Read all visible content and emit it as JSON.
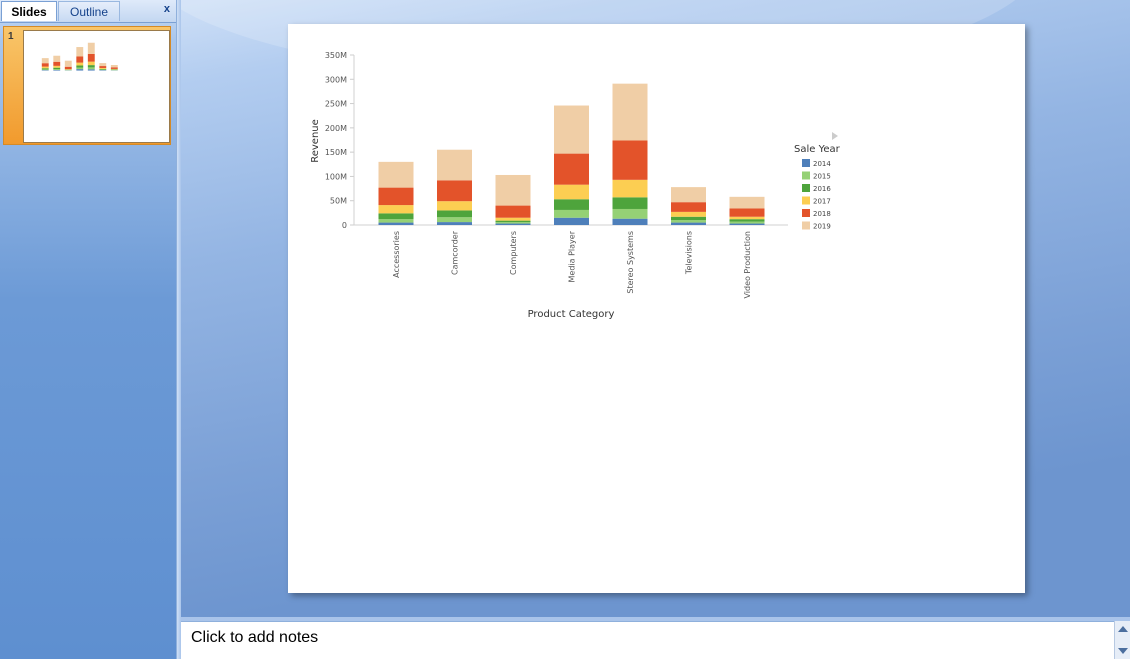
{
  "slides_pane": {
    "tabs": [
      {
        "label": "Slides"
      },
      {
        "label": "Outline"
      }
    ],
    "close_label": "x",
    "thumbnail_number": "1"
  },
  "notes": {
    "placeholder": "Click to add notes"
  },
  "colors": {
    "series": [
      "#4e7fba",
      "#95d175",
      "#4ea43c",
      "#fcce52",
      "#e3532a",
      "#f0cea6"
    ]
  },
  "chart_data": {
    "type": "bar",
    "stacked": true,
    "xlabel": "Product Category",
    "ylabel": "Revenue",
    "ylim": [
      0,
      350000000
    ],
    "yticks": [
      0,
      50000000,
      100000000,
      150000000,
      200000000,
      250000000,
      300000000,
      350000000
    ],
    "ytick_labels": [
      "0",
      "50M",
      "100M",
      "150M",
      "200M",
      "250M",
      "300M",
      "350M"
    ],
    "categories": [
      "Accessories",
      "Camcorder",
      "Computers",
      "Media Player",
      "Stereo Systems",
      "Televisions",
      "Video Production"
    ],
    "legend": {
      "title": "Sale Year",
      "placement": "right"
    },
    "series": [
      {
        "name": "2014",
        "values": [
          5000000,
          6000000,
          3000000,
          15000000,
          13000000,
          5000000,
          3000000
        ]
      },
      {
        "name": "2015",
        "values": [
          7000000,
          10000000,
          3000000,
          16000000,
          20000000,
          5000000,
          4000000
        ]
      },
      {
        "name": "2016",
        "values": [
          12000000,
          14000000,
          3000000,
          22000000,
          24000000,
          7000000,
          5000000
        ]
      },
      {
        "name": "2017",
        "values": [
          17000000,
          19000000,
          6000000,
          30000000,
          36000000,
          10000000,
          5000000
        ]
      },
      {
        "name": "2018",
        "values": [
          36000000,
          43000000,
          25000000,
          64000000,
          81000000,
          20000000,
          17000000
        ]
      },
      {
        "name": "2019",
        "values": [
          53000000,
          63000000,
          63000000,
          99000000,
          117000000,
          31000000,
          24000000
        ]
      }
    ]
  }
}
